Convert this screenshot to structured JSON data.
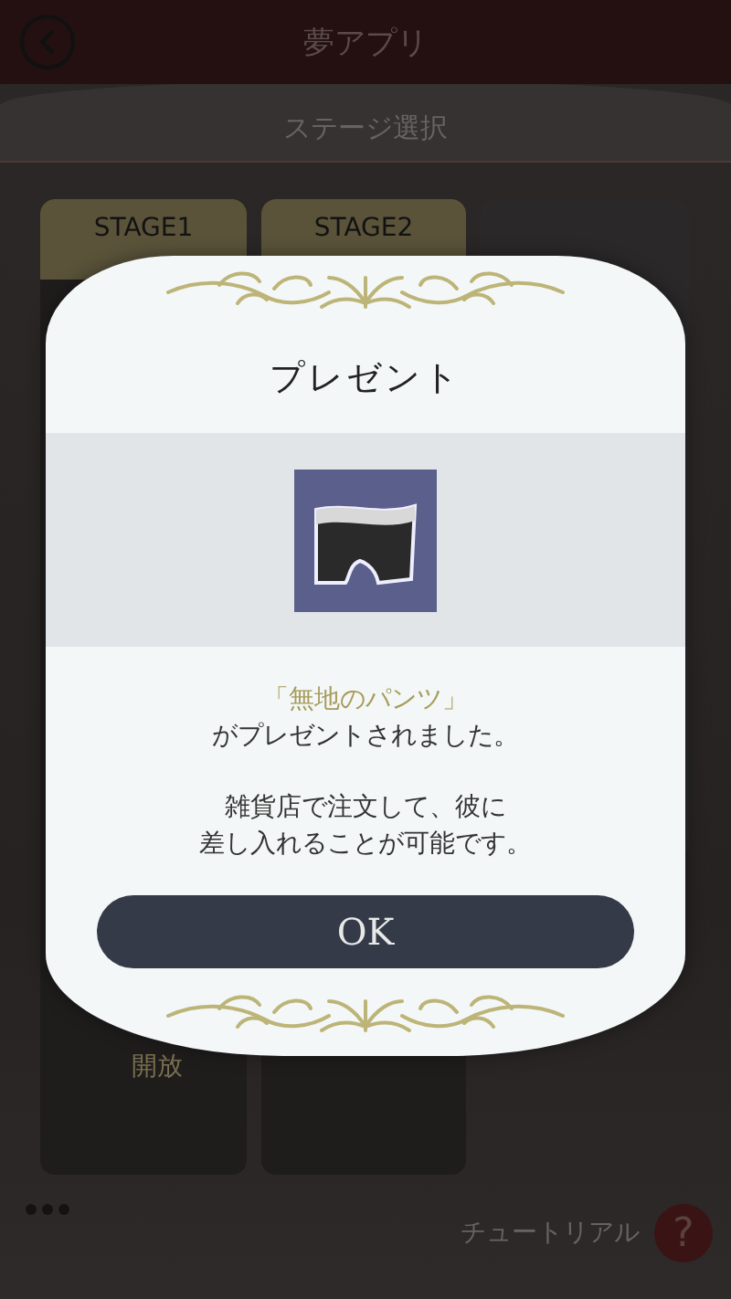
{
  "header": {
    "title": "夢アプリ"
  },
  "subheader": {
    "title": "ステージ選択"
  },
  "stages": [
    {
      "label": "STAGE1",
      "note": "開放",
      "locked": false
    },
    {
      "label": "STAGE2",
      "locked": false
    },
    {
      "locked": true
    }
  ],
  "footer": {
    "tutorial_label": "チュートリアル",
    "help_icon": "?"
  },
  "dialog": {
    "title": "プレゼント",
    "item_name": "「無地のパンツ」",
    "message": "がプレゼントされました。",
    "note_lines": [
      "雑貨店で注文して、彼に",
      "差し入れることが可能です。"
    ],
    "button": "OK"
  }
}
